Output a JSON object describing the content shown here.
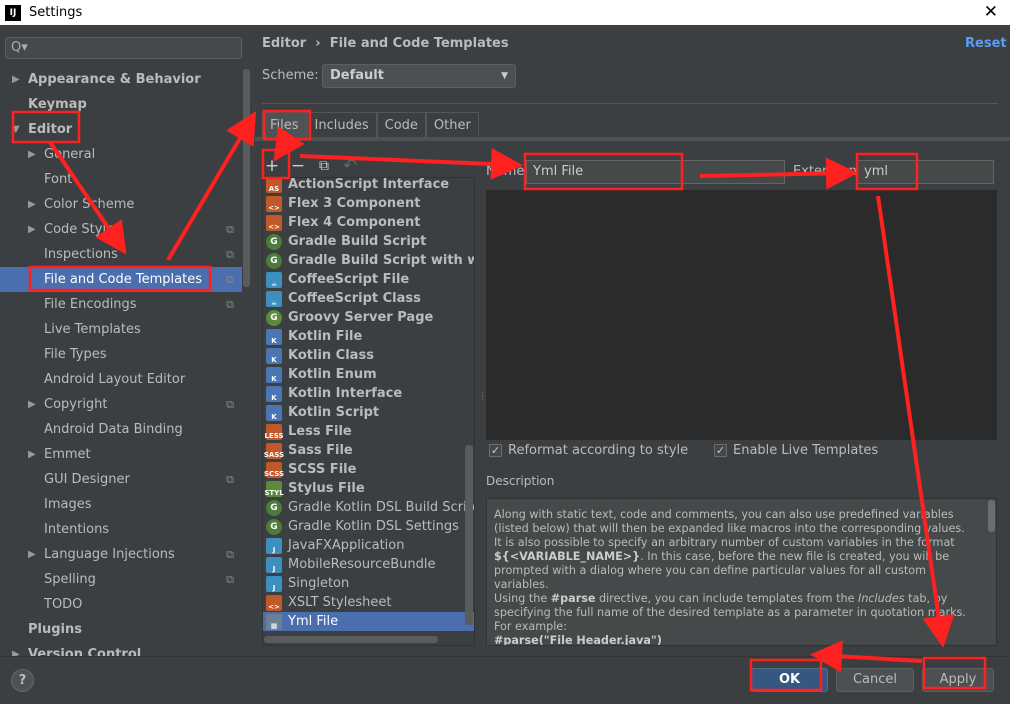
{
  "window": {
    "title": "Settings",
    "close": "✕"
  },
  "search": {
    "icon": "search-icon",
    "glyph": "Q▾"
  },
  "sidebar": {
    "items": [
      {
        "label": "Appearance & Behavior",
        "level": 0,
        "arrow": "▶",
        "bold": true
      },
      {
        "label": "Keymap",
        "level": 0,
        "bold": true
      },
      {
        "label": "Editor",
        "level": 0,
        "arrow": "▼",
        "bold": true
      },
      {
        "label": "General",
        "level": 1,
        "arrow": "▶"
      },
      {
        "label": "Font",
        "level": 1
      },
      {
        "label": "Color Scheme",
        "level": 1,
        "arrow": "▶"
      },
      {
        "label": "Code Style",
        "level": 1,
        "arrow": "▶",
        "copy": true
      },
      {
        "label": "Inspections",
        "level": 1,
        "copy": true
      },
      {
        "label": "File and Code Templates",
        "level": 1,
        "copy": true,
        "selected": true
      },
      {
        "label": "File Encodings",
        "level": 1,
        "copy": true
      },
      {
        "label": "Live Templates",
        "level": 1
      },
      {
        "label": "File Types",
        "level": 1
      },
      {
        "label": "Android Layout Editor",
        "level": 1
      },
      {
        "label": "Copyright",
        "level": 1,
        "arrow": "▶",
        "copy": true
      },
      {
        "label": "Android Data Binding",
        "level": 1
      },
      {
        "label": "Emmet",
        "level": 1,
        "arrow": "▶"
      },
      {
        "label": "GUI Designer",
        "level": 1,
        "copy": true
      },
      {
        "label": "Images",
        "level": 1
      },
      {
        "label": "Intentions",
        "level": 1
      },
      {
        "label": "Language Injections",
        "level": 1,
        "arrow": "▶",
        "copy": true
      },
      {
        "label": "Spelling",
        "level": 1,
        "copy": true
      },
      {
        "label": "TODO",
        "level": 1
      },
      {
        "label": "Plugins",
        "level": 0,
        "bold": true
      },
      {
        "label": "Version Control",
        "level": 0,
        "arrow": "▶",
        "bold": true
      }
    ]
  },
  "header": {
    "breadcrumb_root": "Editor",
    "breadcrumb_sep": "›",
    "breadcrumb_page": "File and Code Templates",
    "reset": "Reset"
  },
  "scheme": {
    "label": "Scheme:",
    "value": "Default"
  },
  "tabs": [
    {
      "label": "Files",
      "active": true
    },
    {
      "label": "Includes"
    },
    {
      "label": "Code"
    },
    {
      "label": "Other"
    }
  ],
  "toolbar": {
    "add": "+",
    "remove": "−",
    "copy": "⧉",
    "reset": "↶"
  },
  "templates": [
    {
      "label": "ActionScript Interface",
      "icon": "AS",
      "color": "#c0582a",
      "bold": true
    },
    {
      "label": "Flex 3 Component",
      "icon": "<>",
      "color": "#c0582a",
      "bold": true
    },
    {
      "label": "Flex 4 Component",
      "icon": "<>",
      "color": "#c0582a",
      "bold": true
    },
    {
      "label": "Gradle Build Script",
      "icon": "G",
      "color": "#4e7a3a",
      "bold": true
    },
    {
      "label": "Gradle Build Script with wrapper",
      "icon": "G",
      "color": "#4e7a3a",
      "bold": true
    },
    {
      "label": "CoffeeScript File",
      "icon": "☕",
      "color": "#3d8fc0",
      "bold": true
    },
    {
      "label": "CoffeeScript Class",
      "icon": "☕",
      "color": "#3d8fc0",
      "bold": true
    },
    {
      "label": "Groovy Server Page",
      "icon": "G",
      "color": "#5b8a3a",
      "bold": true
    },
    {
      "label": "Kotlin File",
      "icon": "K",
      "color": "#4a77b4",
      "bold": true
    },
    {
      "label": "Kotlin Class",
      "icon": "K",
      "color": "#4a77b4",
      "bold": true
    },
    {
      "label": "Kotlin Enum",
      "icon": "K",
      "color": "#4a77b4",
      "bold": true
    },
    {
      "label": "Kotlin Interface",
      "icon": "K",
      "color": "#4a77b4",
      "bold": true
    },
    {
      "label": "Kotlin Script",
      "icon": "K",
      "color": "#4a77b4",
      "bold": true
    },
    {
      "label": "Less File",
      "icon": "LESS",
      "color": "#c0582a",
      "bold": true
    },
    {
      "label": "Sass File",
      "icon": "SASS",
      "color": "#c0582a",
      "bold": true
    },
    {
      "label": "SCSS File",
      "icon": "SCSS",
      "color": "#c0582a",
      "bold": true
    },
    {
      "label": "Stylus File",
      "icon": "STYL",
      "color": "#5b8a3a",
      "bold": true
    },
    {
      "label": "Gradle Kotlin DSL Build Script",
      "icon": "G",
      "color": "#4e7a3a"
    },
    {
      "label": "Gradle Kotlin DSL Settings",
      "icon": "G",
      "color": "#4e7a3a"
    },
    {
      "label": "JavaFXApplication",
      "icon": "J",
      "color": "#3d8fc0"
    },
    {
      "label": "MobileResourceBundle",
      "icon": "J",
      "color": "#3d8fc0"
    },
    {
      "label": "Singleton",
      "icon": "J",
      "color": "#3d8fc0"
    },
    {
      "label": "XSLT Stylesheet",
      "icon": "<>",
      "color": "#c0582a"
    },
    {
      "label": "Yml File",
      "icon": "▦",
      "color": "#6b7f99",
      "selected": true
    }
  ],
  "form": {
    "name_label": "Name:",
    "name_value": "Yml File",
    "ext_label": "Extension:",
    "ext_value": "yml",
    "reformat": {
      "label": "Reformat according to style",
      "checked": true
    },
    "live": {
      "label": "Enable Live Templates",
      "checked": true
    }
  },
  "description": {
    "label": "Description",
    "l1": "Along with static text, code and comments, you can also use predefined variables",
    "l2": "(listed below) that will then be expanded like macros into the corresponding values.",
    "l3": "It is also possible to specify an arbitrary number of custom variables in the format",
    "l4b": "${<VARIABLE_NAME>}",
    "l4": ". In this case, before the new file is created, you will be",
    "l5": "prompted with a dialog where you can define particular values for all custom",
    "l6": "variables.",
    "l7a": "Using the ",
    "l7b": "#parse",
    "l7c": " directive, you can include templates from the ",
    "l7i": "Includes",
    "l7d": " tab, by",
    "l8": "specifying the full name of the desired template as a parameter in quotation marks.",
    "l9": "For example:",
    "l10": "#parse(\"File Header.java\")"
  },
  "buttons": {
    "help": "?",
    "ok": "OK",
    "cancel": "Cancel",
    "apply": "Apply"
  },
  "annotation_color": "#ff2020"
}
